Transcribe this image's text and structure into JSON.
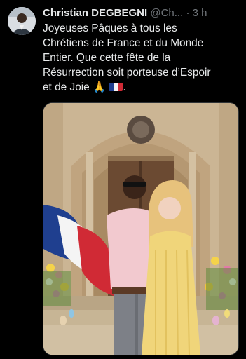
{
  "post": {
    "author_name": "Christian DEGBEGNI",
    "author_handle": "@Ch...",
    "separator": "·",
    "time": "3 h",
    "text_lines": [
      "Joyeuses Pâques à tous les",
      "Chrétiens de France et du Monde",
      "Entier. Que cette fête de la",
      "Résurrection soit porteuse d’Espoir",
      "et de Joie"
    ],
    "emoji_prayer": "🙏",
    "emoji_flag_name": "france-flag-icon",
    "text_end": "."
  },
  "colors": {
    "background": "#000000",
    "text": "#e7e9ea",
    "muted": "#71767b",
    "flag_blue": "#1f3f8f",
    "flag_white": "#f4f4f4",
    "flag_red": "#d02a35"
  },
  "media": {
    "description_icon": "photo-image"
  }
}
